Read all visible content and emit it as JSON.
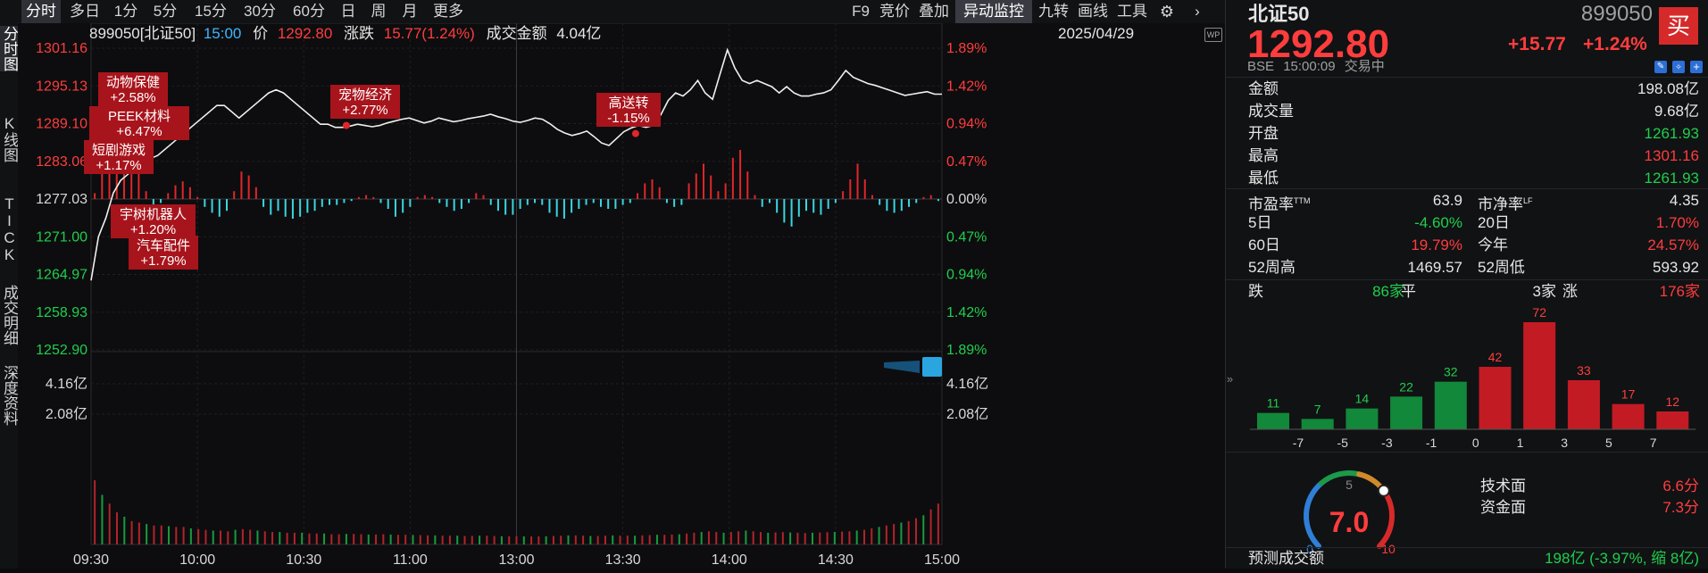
{
  "vtabs": [
    {
      "label": "分时图",
      "active": true
    },
    {
      "label": "K线图",
      "active": false
    },
    {
      "label": "TICK",
      "active": false
    },
    {
      "label": "成交明细",
      "active": false
    },
    {
      "label": "深度资料",
      "active": false
    }
  ],
  "toolbar": {
    "periods": [
      "分时",
      "多日",
      "1分",
      "5分",
      "15分",
      "30分",
      "60分",
      "日",
      "周",
      "月",
      "更多"
    ],
    "right_tools": [
      "F9",
      "竞价",
      "叠加",
      "异动监控",
      "九转",
      "画线",
      "工具"
    ],
    "settings_icon": "gear-icon",
    "more_icon": "chevron-right-icon"
  },
  "infobar": {
    "code_name": "899050[北证50]",
    "time": "15:00",
    "price_label": "价",
    "price": "1292.80",
    "change_label": "涨跌",
    "change": "15.77(1.24%)",
    "amount_label": "成交金额",
    "amount": "4.04亿",
    "date": "2025/04/29"
  },
  "chart_data": {
    "type": "line",
    "price_axis": [
      "1301.16",
      "1295.13",
      "1289.10",
      "1283.06",
      "1277.03",
      "1271.00",
      "1264.97",
      "1258.93",
      "1252.90"
    ],
    "pct_axis": [
      "1.89%",
      "1.42%",
      "0.94%",
      "0.47%",
      "0.00%",
      "0.47%",
      "0.94%",
      "1.42%",
      "1.89%"
    ],
    "vol_axis": [
      "4.16亿",
      "2.08亿"
    ],
    "time_labels": [
      "09:30",
      "10:00",
      "10:30",
      "11:00",
      "13:00",
      "13:30",
      "14:00",
      "14:30",
      "15:00"
    ],
    "prev_close": 1277.03,
    "ylim": [
      1252.9,
      1301.16
    ],
    "price_series": [
      1264,
      1271,
      1274,
      1278,
      1280,
      1281,
      1282,
      1283,
      1283.5,
      1284,
      1285,
      1286,
      1287,
      1288,
      1289,
      1290,
      1291,
      1292,
      1292,
      1291,
      1290,
      1291,
      1292,
      1293,
      1294,
      1294.5,
      1294,
      1293,
      1292,
      1291,
      1290,
      1289,
      1289,
      1288.5,
      1288.5,
      1288.7,
      1289,
      1288.8,
      1288.6,
      1288.8,
      1289.2,
      1289.5,
      1289.8,
      1290,
      1289.6,
      1289.2,
      1289.5,
      1290,
      1289.7,
      1289.4,
      1289.6,
      1289.9,
      1290.1,
      1290.3,
      1290.6,
      1290.2,
      1289.9,
      1289.5,
      1289.3,
      1289.6,
      1290,
      1289.8,
      1289.1,
      1288.2,
      1287.6,
      1287.2,
      1287.5,
      1287.9,
      1287,
      1286,
      1285.6,
      1286.7,
      1287.8,
      1288.4,
      1288.8,
      1288.5,
      1288.8,
      1290.5,
      1292.8,
      1294,
      1293.5,
      1294.5,
      1296,
      1294,
      1293,
      1297,
      1300.9,
      1298,
      1296,
      1295.5,
      1296,
      1295.5,
      1295,
      1294,
      1295,
      1294,
      1293.5,
      1293.5,
      1293.8,
      1294,
      1294.5,
      1296,
      1297.6,
      1296.5,
      1296,
      1295.5,
      1295.2,
      1294.8,
      1294.4,
      1294,
      1293.6,
      1293.8,
      1294,
      1294.2,
      1293.8,
      1293.8
    ],
    "flow_series": [
      0.3,
      1.6,
      2.6,
      3.2,
      2.9,
      2.3,
      1.4,
      0.4,
      -0.4,
      -0.2,
      0.3,
      0.7,
      0.9,
      0.6,
      0.1,
      -0.4,
      -0.7,
      -0.9,
      -0.6,
      0.4,
      1.4,
      1.2,
      0.6,
      -0.4,
      -0.8,
      -0.6,
      -0.9,
      -1.0,
      -0.9,
      -0.7,
      -0.6,
      -0.4,
      -0.3,
      -0.3,
      -0.2,
      -0.1,
      0.1,
      0.2,
      0.1,
      -0.2,
      -0.5,
      -0.9,
      -0.7,
      -0.4,
      0.1,
      0.2,
      0.1,
      -0.2,
      -0.4,
      -0.6,
      -0.5,
      -0.2,
      0.3,
      0.2,
      -0.3,
      -0.6,
      -0.8,
      -0.8,
      -0.5,
      -0.3,
      -0.2,
      -0.3,
      -0.7,
      -0.9,
      -1.0,
      -0.7,
      -0.5,
      -0.3,
      -0.2,
      -0.4,
      -0.5,
      -0.5,
      -0.3,
      -0.2,
      0.3,
      0.8,
      1.0,
      0.6,
      -0.2,
      -0.4,
      -0.3,
      0.8,
      1.3,
      1.8,
      1.2,
      0.4,
      0.8,
      2.1,
      2.5,
      1.4,
      0.2,
      -0.4,
      -0.2,
      -0.7,
      -1.2,
      -1.4,
      -0.9,
      -0.6,
      -0.7,
      -0.8,
      -0.5,
      -0.2,
      0.4,
      1.0,
      1.8,
      1.0,
      0.2,
      -0.3,
      -0.6,
      -0.7,
      -0.6,
      -0.4,
      -0.2,
      0.1,
      0.2,
      -0.1
    ],
    "volume_series": [
      4.4,
      3.4,
      2.8,
      2.2,
      1.9,
      1.6,
      1.5,
      1.4,
      1.3,
      1.3,
      1.25,
      1.2,
      1.2,
      1.1,
      1.05,
      1.0,
      0.95,
      0.95,
      0.9,
      1.0,
      1.05,
      1.0,
      0.95,
      0.9,
      0.85,
      0.85,
      0.8,
      0.8,
      0.8,
      0.75,
      0.75,
      0.75,
      0.7,
      0.7,
      0.72,
      0.72,
      0.7,
      0.68,
      0.68,
      0.7,
      0.68,
      0.66,
      0.66,
      0.65,
      0.64,
      0.62,
      0.62,
      0.6,
      0.6,
      0.6,
      0.58,
      0.58,
      0.6,
      0.6,
      0.58,
      0.56,
      0.56,
      0.55,
      0.55,
      0.55,
      0.55,
      0.56,
      0.58,
      0.6,
      0.62,
      0.62,
      0.6,
      0.58,
      0.58,
      0.6,
      0.62,
      0.6,
      0.6,
      0.6,
      0.62,
      0.64,
      0.66,
      0.66,
      0.68,
      0.7,
      0.75,
      0.8,
      0.85,
      0.9,
      0.85,
      0.8,
      0.85,
      0.9,
      0.95,
      0.9,
      0.85,
      0.8,
      0.82,
      0.84,
      0.82,
      0.8,
      0.78,
      0.8,
      0.82,
      0.84,
      0.86,
      0.88,
      0.9,
      0.95,
      1.0,
      1.1,
      1.2,
      1.3,
      1.4,
      1.5,
      1.6,
      1.8,
      2.0,
      2.4,
      2.8
    ],
    "grid": true
  },
  "annotations": [
    {
      "name": "动物保健",
      "pct": "+2.58%"
    },
    {
      "name": "PEEK材料",
      "pct": "+6.47%"
    },
    {
      "name": "短剧游戏",
      "pct": "+1.17%"
    },
    {
      "name": "宇树机器人",
      "pct": "+1.20%"
    },
    {
      "name": "汽车配件",
      "pct": "+1.79%"
    },
    {
      "name": "宠物经济",
      "pct": "+2.77%"
    },
    {
      "name": "高送转",
      "pct": "-1.15%"
    }
  ],
  "quote": {
    "name": "北证50",
    "code": "899050",
    "price": "1292.80",
    "change": "+15.77",
    "change_pct": "+1.24%",
    "exchange": "BSE",
    "time": "15:00:09",
    "status": "交易中",
    "buy_label": "买"
  },
  "stats": [
    {
      "label": "金额",
      "value": "198.08亿",
      "color": "white"
    },
    {
      "label": "成交量",
      "value": "9.68亿",
      "color": "white"
    },
    {
      "label": "开盘",
      "value": "1261.93",
      "color": "green"
    },
    {
      "label": "最高",
      "value": "1301.16",
      "color": "red"
    },
    {
      "label": "最低",
      "value": "1261.93",
      "color": "green"
    }
  ],
  "stats2": [
    {
      "l1": "市盈率",
      "s1": "TTM",
      "v1": "63.9",
      "c1": "white",
      "l2": "市净率",
      "s2": "LF",
      "v2": "4.35",
      "c2": "white"
    },
    {
      "l1": "5日",
      "s1": "",
      "v1": "-4.60%",
      "c1": "green",
      "l2": "20日",
      "s2": "",
      "v2": "1.70%",
      "c2": "red"
    },
    {
      "l1": "60日",
      "s1": "",
      "v1": "19.79%",
      "c1": "red",
      "l2": "今年",
      "s2": "",
      "v2": "24.57%",
      "c2": "red"
    },
    {
      "l1": "52周高",
      "s1": "",
      "v1": "1469.57",
      "c1": "white",
      "l2": "52周低",
      "s2": "",
      "v2": "593.92",
      "c2": "white"
    }
  ],
  "breadth": {
    "down_label": "跌",
    "down": "86家",
    "flat_label": "平",
    "flat": "3家",
    "up_label": "涨",
    "up": "176家"
  },
  "dist_chart": {
    "type": "bar",
    "categories": [
      "-7",
      "-5",
      "-3",
      "-1",
      "0",
      "1",
      "3",
      "5",
      "7"
    ],
    "x_ticks": [
      "-7",
      "-5",
      "-3",
      "-1",
      "0",
      "1",
      "3",
      "5",
      "7"
    ],
    "values": [
      11,
      7,
      14,
      22,
      32,
      42,
      72,
      33,
      17,
      12
    ],
    "colors": [
      "green",
      "green",
      "green",
      "green",
      "green",
      "red",
      "red",
      "red",
      "red",
      "red"
    ]
  },
  "gauge": {
    "score": "7.0",
    "min": "0",
    "mid": "5",
    "max": "10",
    "value": 7.0,
    "tech_label": "技术面",
    "tech": "6.6分",
    "fund_label": "资金面",
    "fund": "7.3分"
  },
  "forecast": {
    "label": "预测成交额",
    "value": "198亿 (-3.97%, 缩 8亿)"
  }
}
